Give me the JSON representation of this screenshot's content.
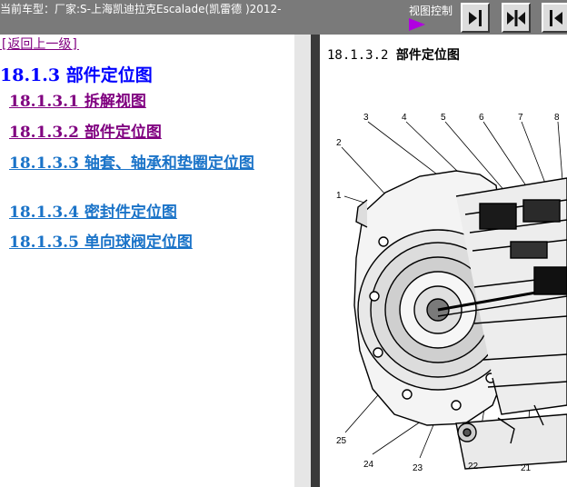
{
  "topbar": {
    "vehicle_title": "当前车型：厂家:S-上海凯迪拉克Escalade(凯雷德 )2012-",
    "view_control_label": "视图控制",
    "buttons": [
      {
        "name": "show-right-pane-button",
        "icon": "arrow-right-bar-icon"
      },
      {
        "name": "split-pane-button",
        "icon": "double-arrow-icon"
      },
      {
        "name": "show-left-pane-button",
        "icon": "arrow-left-bar-icon"
      }
    ]
  },
  "nav": {
    "back_link": "[返回上一级]",
    "section_heading": "18.1.3 部件定位图",
    "items": [
      {
        "label": "18.1.3.1 拆解视图",
        "visited": true
      },
      {
        "label": "18.1.3.2 部件定位图",
        "visited": true
      },
      {
        "label": "18.1.3.3 轴套、轴承和垫圈定位图",
        "visited": false
      },
      {
        "label": "18.1.3.4 密封件定位图",
        "visited": false
      },
      {
        "label": "18.1.3.5 单向球阀定位图",
        "visited": false
      }
    ]
  },
  "content": {
    "figure_number": "18.1.3.2",
    "figure_title": "部件定位图",
    "callouts": [
      "1",
      "2",
      "3",
      "4",
      "5",
      "6",
      "7",
      "8",
      "21",
      "22",
      "23",
      "24",
      "25"
    ]
  },
  "colors": {
    "topbar_bg": "#7a7a7a",
    "link_visited": "#800080",
    "link_normal": "#1a73c8",
    "heading_blue": "#0000ff",
    "arrow_purple": "#b000e0"
  }
}
